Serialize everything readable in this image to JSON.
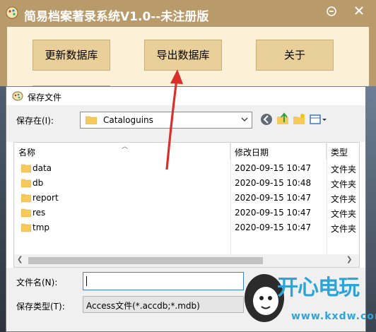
{
  "app": {
    "title": "简易档案著录系统V1.0--未注册版",
    "buttons": [
      "更新数据库",
      "导出数据库",
      "关于"
    ]
  },
  "dialog": {
    "title": "保存文件",
    "save_in_label": "保存在(I):",
    "save_in_value": "Cataloguins",
    "columns": {
      "name": "名称",
      "date": "修改日期",
      "type": "类型"
    },
    "files": [
      {
        "name": "data",
        "date": "2020-09-15 10:47",
        "type": "文件夹"
      },
      {
        "name": "db",
        "date": "2020-09-15 10:48",
        "type": "文件夹"
      },
      {
        "name": "report",
        "date": "2020-09-15 10:47",
        "type": "文件夹"
      },
      {
        "name": "res",
        "date": "2020-09-15 10:47",
        "type": "文件夹"
      },
      {
        "name": "tmp",
        "date": "2020-09-15 10:47",
        "type": "文件夹"
      }
    ],
    "filename_label": "文件名(N):",
    "filename_value": "",
    "filetype_label": "保存类型(T):",
    "filetype_value": "Access文件(*.accdb;*.mdb)"
  },
  "watermark": {
    "brand": "开心电玩",
    "url": "www.kxdw.com"
  },
  "colors": {
    "app_titlebar": "#b99a6a",
    "app_body": "#fcf0d7",
    "app_button": "#e9d09a",
    "arrow": "#d9302a",
    "watermark": "#2ea3d8"
  }
}
